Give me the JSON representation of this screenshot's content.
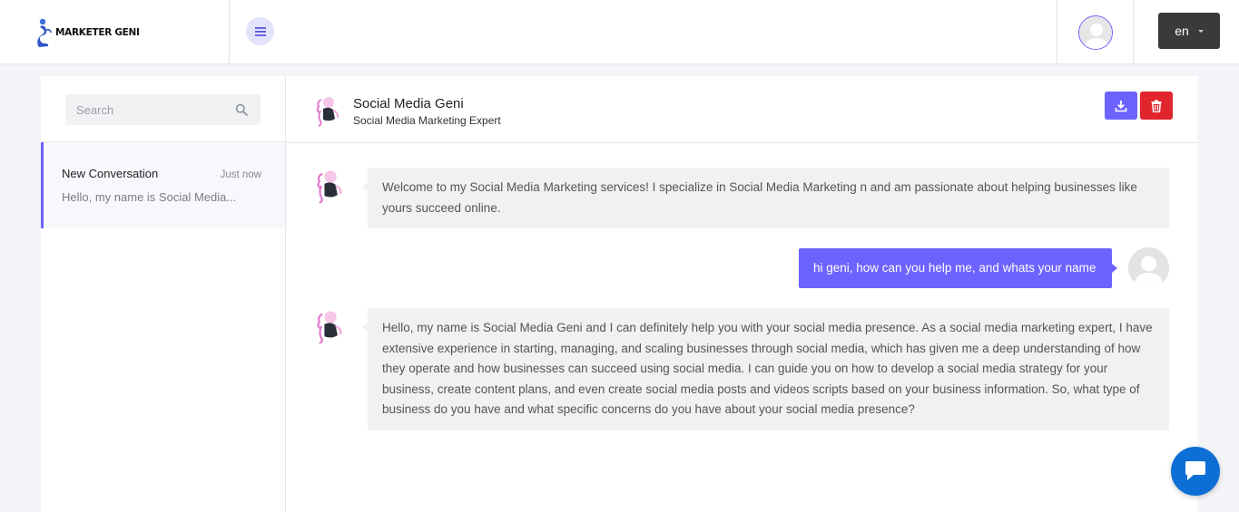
{
  "brand": {
    "name": "MARKETER GENI"
  },
  "header": {
    "language": "en"
  },
  "sidebar": {
    "search_placeholder": "Search",
    "conversations": [
      {
        "title": "New Conversation",
        "time": "Just now",
        "preview": "Hello, my name is Social Media..."
      }
    ]
  },
  "chat": {
    "agent_name": "Social Media Geni",
    "agent_role": "Social Media Marketing Expert",
    "messages": [
      {
        "from": "bot",
        "text": "Welcome to my Social Media Marketing services! I specialize in Social Media Marketing n and am passionate about helping businesses like yours succeed online."
      },
      {
        "from": "user",
        "text": "hi geni, how can you help me, and whats your name"
      },
      {
        "from": "bot",
        "text": "Hello, my name is Social Media Geni and I can definitely help you with your social media presence. As a social media marketing expert, I have extensive experience in starting, managing, and scaling businesses through social media, which has given me a deep understanding of how they operate and how businesses can succeed using social media. I can guide you on how to develop a social media strategy for your business, create content plans, and even create social media posts and videos scripts based on your business information. So, what type of business do you have and what specific concerns do you have about your social media presence?"
      }
    ]
  },
  "colors": {
    "accent": "#6c63ff",
    "danger": "#e0262c",
    "chat_widget": "#0d6fd6",
    "dark_button": "#3a3a3a"
  }
}
